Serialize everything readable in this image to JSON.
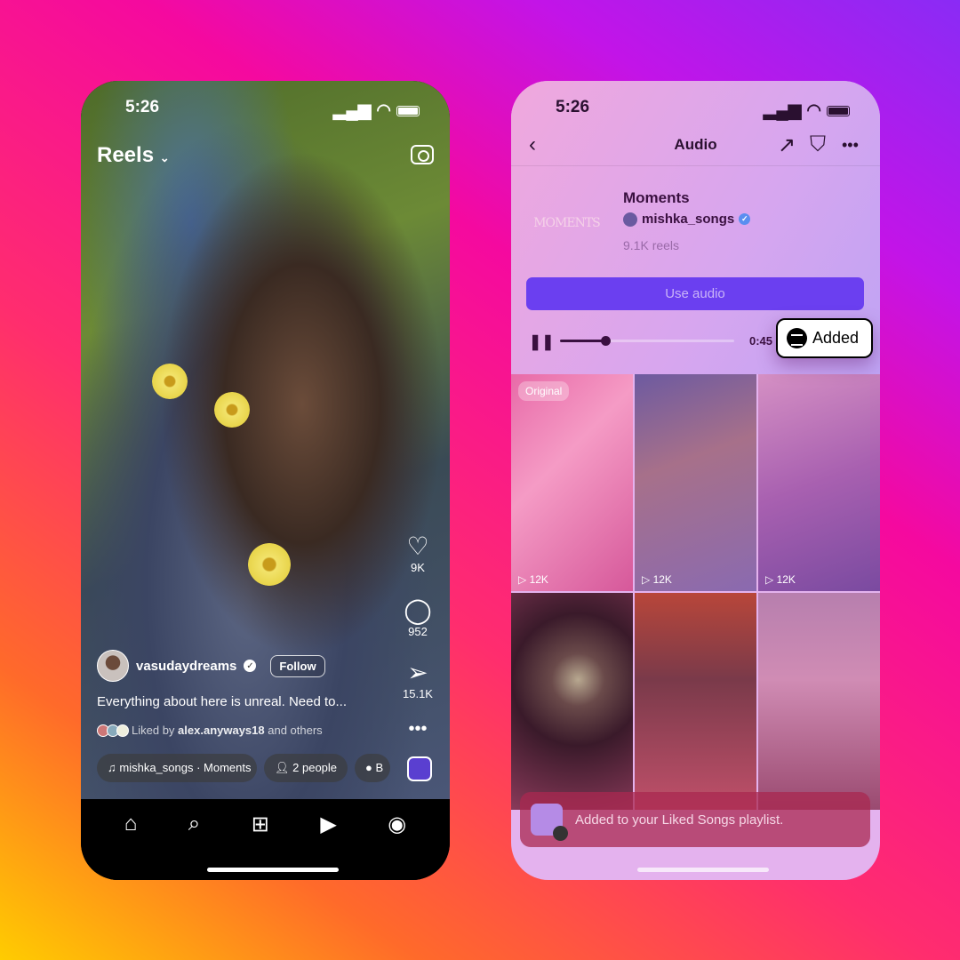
{
  "reels_phone": {
    "status": {
      "time": "5:26"
    },
    "title": "Reels",
    "actions": {
      "likes": "9K",
      "comments": "952",
      "shares": "15.1K"
    },
    "post": {
      "username": "vasudaydreams",
      "follow_label": "Follow",
      "caption": "Everything about here is unreal. Need to...",
      "liked_prefix": "Liked by",
      "liked_user": "alex.anyways18",
      "liked_suffix": "and others"
    },
    "pills": {
      "audio": "mishka_songs · Moments",
      "people": "2 people",
      "location": "B"
    },
    "nav": [
      "home-icon",
      "search-icon",
      "create-icon",
      "reels-icon",
      "profile-icon"
    ]
  },
  "audio_phone": {
    "status": {
      "time": "5:26"
    },
    "header": {
      "title": "Audio"
    },
    "song": {
      "title": "Moments",
      "cover_text": "MOMENTS",
      "artist": "mishka_songs",
      "reels": "9.1K reels"
    },
    "use_audio_label": "Use audio",
    "player": {
      "duration": "0:45",
      "progress": 0.26
    },
    "spotify_badge": "Added",
    "grid": [
      {
        "badge": "Original",
        "views": "12K",
        "bg": "linear-gradient(135deg,#e86aa8,#f59bc5 40%,#d6589a)"
      },
      {
        "views": "12K",
        "bg": "linear-gradient(160deg,#6d5aa0,#a7708a 40%,#8a6ab0)"
      },
      {
        "views": "12K",
        "bg": "linear-gradient(160deg,#d590c4,#a860b0 50%,#7a4aa0)"
      },
      {
        "bg": "radial-gradient(circle at 55% 40%,#b8a890 0,#6a4a4a 18%,#3a1a2a 45%,#8a3a5a 100%)"
      },
      {
        "bg": "linear-gradient(180deg,#b8463a,#7a3a4a 40%,#c0506a)"
      },
      {
        "bg": "linear-gradient(180deg,#b77fae,#d08cb4 40%,#9a4a70)"
      }
    ],
    "toast": "Added to your Liked Songs playlist.",
    "colors": {
      "accent": "#6b3ff0",
      "spotify": "#000000"
    }
  }
}
